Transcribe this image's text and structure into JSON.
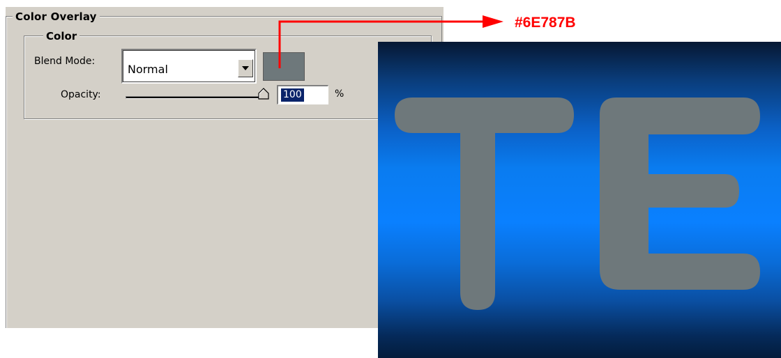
{
  "panel": {
    "group_title": "Color Overlay",
    "subgroup_title": "Color",
    "blend_mode": {
      "label": "Blend Mode:",
      "selected": "Normal"
    },
    "color_swatch": {
      "color": "#6E787B"
    },
    "opacity": {
      "label": "Opacity:",
      "value": "100",
      "unit": "%",
      "slider_level_percent": 100
    }
  },
  "callout": {
    "hex": "#6E787B",
    "color": "#FF0000"
  },
  "preview": {
    "text": "TE",
    "fill_color": "#6E787B",
    "background": "blue vertical gradient"
  }
}
